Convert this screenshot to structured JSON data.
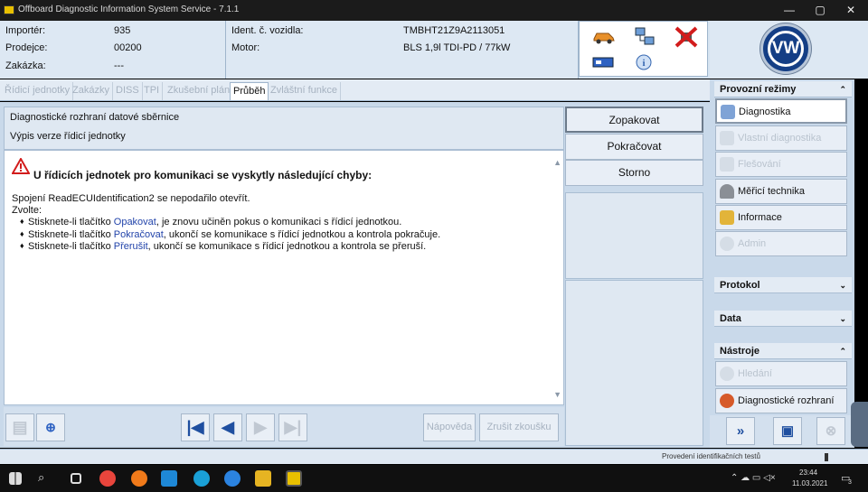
{
  "window": {
    "title": "Offboard Diagnostic Information System Service - 7.1.1",
    "min": "—",
    "max": "▢",
    "close": "✕"
  },
  "header": {
    "importer_label": "Importér:",
    "importer_value": "935",
    "dealer_label": "Prodejce:",
    "dealer_value": "00200",
    "order_label": "Zakázka:",
    "order_value": "---",
    "vin_label": "Ident. č. vozidla:",
    "vin_value": "TMBHT21Z9A2113051",
    "engine_label": "Motor:",
    "engine_value": "BLS 1,9l TDI-PD / 77kW",
    "logo_text": "VW"
  },
  "tabs": [
    "Řídicí jednotky",
    "Zakázky",
    "DISS",
    "TPI",
    "Zkušební plán",
    "Průběh",
    "Zvláštní funkce"
  ],
  "active_tab": "Průběh",
  "panel": {
    "line1": "Diagnostické rozhraní datové sběrnice",
    "line2": "Výpis verze řídicí jednotky"
  },
  "message": {
    "title": "U řídicích jednotek pro komunikaci se vyskytly následující chyby:",
    "line1": "Spojení ReadECUIdentification2 se nepodařilo otevřít.",
    "line2": "Zvolte:",
    "b1_pre": "Stisknete-li tlačítko ",
    "b1_link": "Opakovat",
    "b1_post": ", je znovu učiněn pokus o komunikaci s řídicí jednotkou.",
    "b2_pre": "Stisknete-li tlačítko ",
    "b2_link": "Pokračovat",
    "b2_post": ", ukončí se komunikace s řídicí jednotkou a kontrola pokračuje.",
    "b3_pre": "Stisknete-li tlačítko ",
    "b3_link": "Přerušit",
    "b3_post": ", ukončí se komunikace s řídicí jednotkou a kontrola se přeruší."
  },
  "actions": {
    "repeat": "Zopakovat",
    "continue": "Pokračovat",
    "cancel": "Storno"
  },
  "bottom": {
    "help": "Nápověda",
    "cancel_test": "Zrušit zkoušku"
  },
  "sidebar": {
    "modes_title": "Provozní režimy",
    "modes": [
      {
        "label": "Diagnostika",
        "state": "active"
      },
      {
        "label": "Vlastní diagnostika",
        "state": "disabled"
      },
      {
        "label": "Flešování",
        "state": "disabled"
      },
      {
        "label": "Měřicí technika",
        "state": "normal"
      },
      {
        "label": "Informace",
        "state": "normal"
      },
      {
        "label": "Admin",
        "state": "disabled"
      }
    ],
    "protocol_title": "Protokol",
    "data_title": "Data",
    "tools_title": "Nástroje",
    "tools": [
      {
        "label": "Hledání",
        "state": "disabled"
      },
      {
        "label": "Diagnostické rozhraní",
        "state": "normal"
      }
    ]
  },
  "status": {
    "text": "Provedení identifikačních testů"
  },
  "taskbar": {
    "time": "23:44",
    "date": "11.03.2021",
    "notif": "3"
  }
}
